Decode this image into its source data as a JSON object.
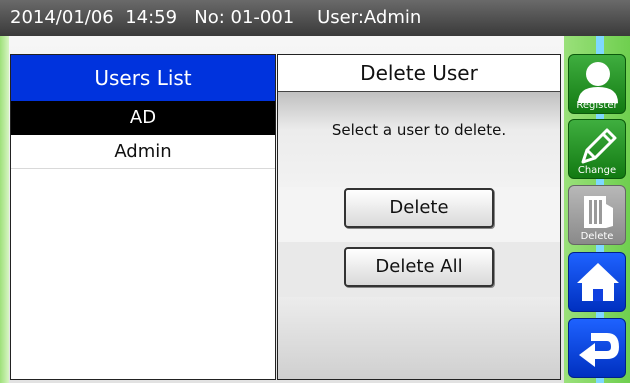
{
  "status_bar": {
    "text": "2014/01/06  14:59   No: 01-001    User:Admin"
  },
  "users_list": {
    "title": "Users List",
    "users": [
      "AD",
      "Admin"
    ],
    "selected_index": 0
  },
  "delete_panel": {
    "title": "Delete User",
    "instruction": "Select a user to delete.",
    "delete_button": "Delete",
    "delete_all_button": "Delete All"
  },
  "side_menu": {
    "register_label": "Register",
    "change_label": "Change",
    "delete_label": "Delete",
    "home_icon": "home-icon",
    "back_icon": "return-icon"
  },
  "colors": {
    "users_header": "#0033dd",
    "selected_row": "#000000",
    "side_green": "#1a8a1a",
    "side_blue": "#1040e0",
    "side_gray": "#9a9a9a"
  }
}
